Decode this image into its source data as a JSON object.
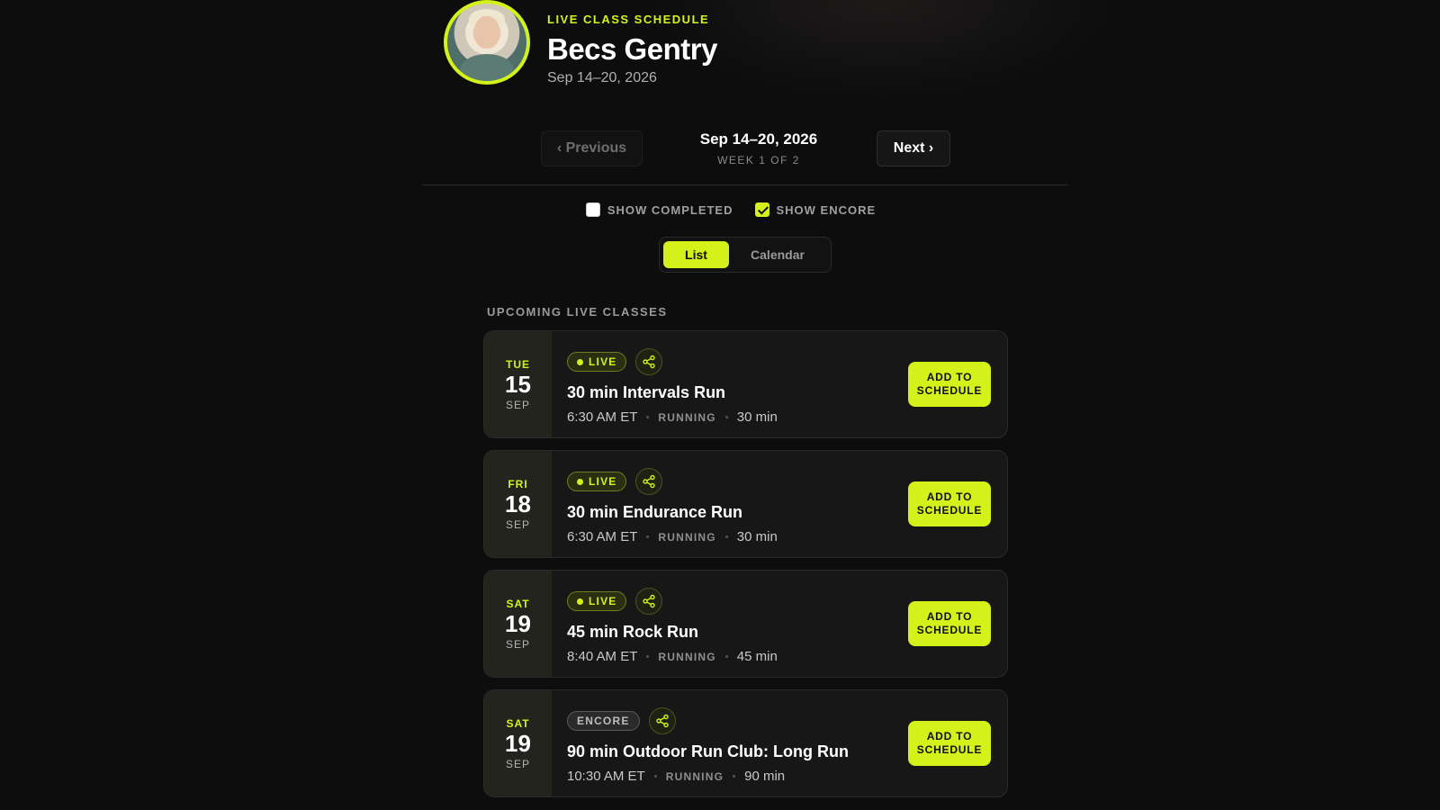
{
  "header": {
    "eyebrow": "LIVE CLASS SCHEDULE",
    "instructor": "Becs Gentry",
    "date_range": "Sep 14–20, 2026"
  },
  "week_nav": {
    "previous_label": "‹ Previous",
    "next_label": "Next ›",
    "range": "Sep 14–20, 2026",
    "week_index": "WEEK 1 OF 2"
  },
  "filters": {
    "show_completed": {
      "label": "SHOW COMPLETED",
      "checked": false
    },
    "show_encore": {
      "label": "SHOW ENCORE",
      "checked": true
    }
  },
  "view_toggle": {
    "options": [
      "List",
      "Calendar"
    ],
    "selected": "List"
  },
  "section_label": "UPCOMING LIVE CLASSES",
  "classes": [
    {
      "dow": "TUE",
      "day": "15",
      "month": "SEP",
      "badge": "LIVE",
      "title": "30 min Intervals Run",
      "time": "6:30 AM ET",
      "discipline": "RUNNING",
      "duration": "30 min",
      "action": "ADD TO SCHEDULE"
    },
    {
      "dow": "FRI",
      "day": "18",
      "month": "SEP",
      "badge": "LIVE",
      "title": "30 min Endurance Run",
      "time": "6:30 AM ET",
      "discipline": "RUNNING",
      "duration": "30 min",
      "action": "ADD TO SCHEDULE"
    },
    {
      "dow": "SAT",
      "day": "19",
      "month": "SEP",
      "badge": "LIVE",
      "title": "45 min Rock Run",
      "time": "8:40 AM ET",
      "discipline": "RUNNING",
      "duration": "45 min",
      "action": "ADD TO SCHEDULE"
    },
    {
      "dow": "SAT",
      "day": "19",
      "month": "SEP",
      "badge": "ENCORE",
      "title": "90 min Outdoor Run Club: Long Run",
      "time": "10:30 AM ET",
      "discipline": "RUNNING",
      "duration": "90 min",
      "action": "ADD TO SCHEDULE"
    }
  ],
  "colors": {
    "accent": "#d4f219",
    "background": "#0d0d0d",
    "card": "#171717"
  },
  "icons": {
    "share": "share-icon",
    "live_dot": "live-dot-icon",
    "check": "check-icon"
  }
}
